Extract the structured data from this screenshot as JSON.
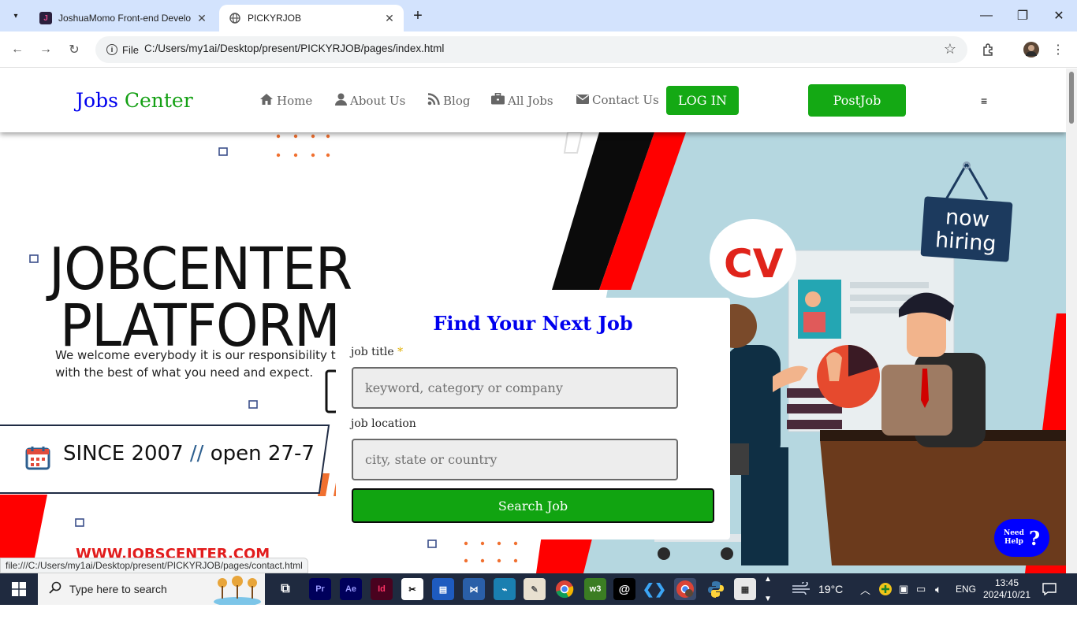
{
  "browser": {
    "tabs": [
      {
        "title": "JoshuaMomo Front-end Develo",
        "favicon": "J",
        "active": false
      },
      {
        "title": "PICKYRJOB",
        "favicon": "globe",
        "active": true
      }
    ],
    "address": {
      "chip": "File",
      "url": "C:/Users/my1ai/Desktop/present/PICKYRJOB/pages/index.html"
    },
    "status_url": "file:///C:/Users/my1ai/Desktop/present/PICKYRJOB/pages/contact.html"
  },
  "site": {
    "logo": {
      "part1": "Jobs",
      "part2": "Center"
    },
    "nav": [
      {
        "label": "Home",
        "icon": "home-icon"
      },
      {
        "label": "About Us",
        "icon": "user-icon"
      },
      {
        "label": "Blog",
        "icon": "rss-icon"
      },
      {
        "label": "All Jobs",
        "icon": "briefcase-icon"
      },
      {
        "label": "Contact Us",
        "icon": "envelope-icon"
      }
    ],
    "login_label": "LOG IN",
    "postjob_label": "PostJob",
    "menu_icon": "≡"
  },
  "hero": {
    "title_line1": "JOBCENTER",
    "title_line2": "PLATFORM",
    "subtitle_line1": "We welcome everybody it is our responsibility to p",
    "subtitle_line2": "with the best of what you need and expect.",
    "since": "SINCE 2007",
    "open": "open 27-7",
    "footer_url": "WWW.JOBSCENTER.COM",
    "sign_line1": "now",
    "sign_line2": "hiring",
    "cv_label": "CV"
  },
  "search": {
    "title": "Find Your Next Job",
    "job_title_label": "job title",
    "required_mark": "*",
    "job_title_placeholder": "keyword, category or company",
    "location_label": "job location",
    "location_placeholder": "city, state or country",
    "button_label": "Search Job"
  },
  "help": {
    "line1": "Need",
    "line2": "Help",
    "symbol": "?"
  },
  "taskbar": {
    "search_placeholder": "Type here to search",
    "weather": "19°C",
    "language": "ENG",
    "time": "13:45",
    "date": "2024/10/21"
  },
  "colors": {
    "brand_blue": "#0000ee",
    "brand_green": "#14a914",
    "hero_red": "#ff0000",
    "hero_bg_blue": "#b3d6e0",
    "taskbar": "#1f2a3f"
  }
}
